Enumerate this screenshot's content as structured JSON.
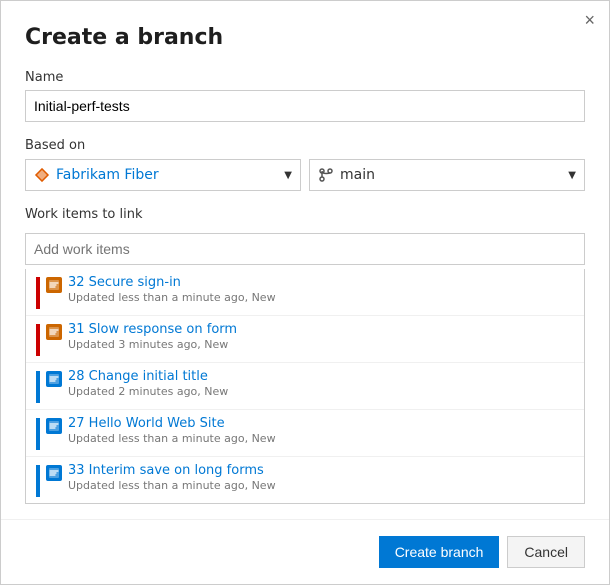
{
  "dialog": {
    "title": "Create a branch",
    "close_label": "×"
  },
  "name_field": {
    "label": "Name",
    "value": "Initial-perf-tests",
    "placeholder": ""
  },
  "based_on": {
    "label": "Based on",
    "repo": {
      "name": "Fabrikam Fiber",
      "dropdown_aria": "Select repository"
    },
    "branch": {
      "name": "main",
      "dropdown_aria": "Select branch"
    }
  },
  "work_items": {
    "label": "Work items to link",
    "placeholder": "Add work items",
    "items": [
      {
        "id": 32,
        "title": "Secure sign-in",
        "meta": "Updated less than a minute ago, New",
        "priority_color": "#cc0000",
        "icon_color": "#cc6600"
      },
      {
        "id": 31,
        "title": "Slow response on form",
        "meta": "Updated 3 minutes ago, New",
        "priority_color": "#cc0000",
        "icon_color": "#cc6600"
      },
      {
        "id": 28,
        "title": "Change initial title",
        "meta": "Updated 2 minutes ago, New",
        "priority_color": "#0078d4",
        "icon_color": "#0078d4"
      },
      {
        "id": 27,
        "title": "Hello World Web Site",
        "meta": "Updated less than a minute ago, New",
        "priority_color": "#0078d4",
        "icon_color": "#0078d4"
      },
      {
        "id": 33,
        "title": "Interim save on long forms",
        "meta": "Updated less than a minute ago, New",
        "priority_color": "#0078d4",
        "icon_color": "#0078d4"
      }
    ]
  },
  "footer": {
    "create_label": "Create branch",
    "cancel_label": "Cancel"
  }
}
